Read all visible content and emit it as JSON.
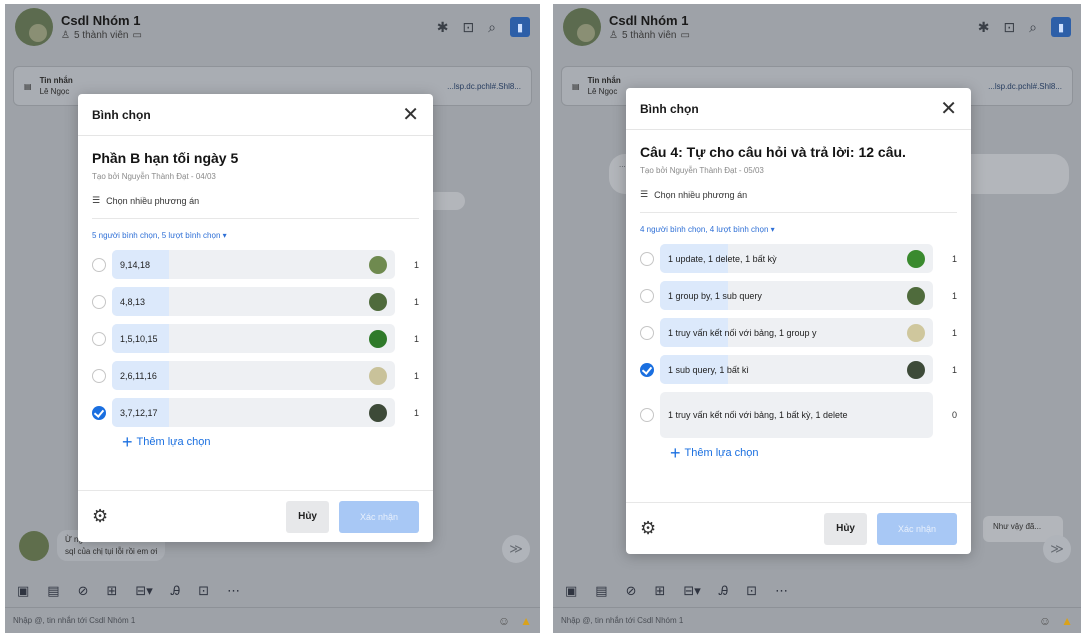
{
  "screens": [
    {
      "group_name": "Csdl Nhóm 1",
      "member_count": "5 thành viên",
      "pinned_title": "Tin nhắn",
      "pinned_sender": "Lê Ngọc",
      "pinned_link": "...lsp.dc.pchl#.Shl8...",
      "bg_bubble": "",
      "bottom_message": [
        "Ừ ngữ",
        "sql của chị tụi lỗi rồi em ơi"
      ],
      "input_placeholder": "Nhập @, tin nhắn tới Csdl Nhóm 1",
      "modal": {
        "title": "Bình chọn",
        "question": "Phần B hạn tối ngày 5",
        "creator": "Tạo bởi Nguyễn Thành Đạt - 04/03",
        "multi_choice_label": "Chọn nhiều phương án",
        "vote_summary": "5 người bình chọn, 5 lượt bình chọn",
        "add_option_label": "Thêm lựa chọn",
        "cancel_label": "Hủy",
        "confirm_label": "Xác nhận",
        "options": [
          {
            "label": "9,14,18",
            "votes": "1",
            "checked": false,
            "share": 0.2,
            "avatar_color": "#6f8a4f"
          },
          {
            "label": "4,8,13",
            "votes": "1",
            "checked": false,
            "share": 0.2,
            "avatar_color": "#4f6b3c"
          },
          {
            "label": "1,5,10,15",
            "votes": "1",
            "checked": false,
            "share": 0.2,
            "avatar_color": "#2f7a2a"
          },
          {
            "label": "2,6,11,16",
            "votes": "1",
            "checked": false,
            "share": 0.2,
            "avatar_color": "#c9c29a"
          },
          {
            "label": "3,7,12,17",
            "votes": "1",
            "checked": true,
            "share": 0.2,
            "avatar_color": "#3d4a38"
          }
        ]
      }
    },
    {
      "group_name": "Csdl Nhóm 1",
      "member_count": "5 thành viên",
      "pinned_title": "Tin nhắn",
      "pinned_sender": "Lê Ngọc",
      "pinned_link": "...lsp.dc.pchl#.Shl8...",
      "bg_bubble": "...",
      "bottom_message": [
        "Như vậy đã..."
      ],
      "input_placeholder": "Nhập @, tin nhắn tới Csdl Nhóm 1",
      "modal": {
        "title": "Bình chọn",
        "question": "Câu 4: Tự cho câu hỏi và trả lời: 12 câu.",
        "creator": "Tạo bởi Nguyễn Thành Đạt - 05/03",
        "multi_choice_label": "Chọn nhiều phương án",
        "vote_summary": "4 người bình chọn, 4 lượt bình chọn",
        "add_option_label": "Thêm lựa chọn",
        "cancel_label": "Hủy",
        "confirm_label": "Xác nhận",
        "options": [
          {
            "label": "1 update, 1 delete, 1 bất kỳ",
            "votes": "1",
            "checked": false,
            "share": 0.25,
            "avatar_color": "#3a8a2e"
          },
          {
            "label": "1 group by, 1 sub query",
            "votes": "1",
            "checked": false,
            "share": 0.25,
            "avatar_color": "#4f6b3c"
          },
          {
            "label": "1 truy vấn kết nối với bảng, 1 group y",
            "votes": "1",
            "checked": false,
            "share": 0.25,
            "avatar_color": "#cfc79d"
          },
          {
            "label": "1 sub query, 1 bất kì",
            "votes": "1",
            "checked": true,
            "share": 0.25,
            "avatar_color": "#3d4a38"
          },
          {
            "label": "1 truy vấn kết nối với bảng, 1 bất kỳ, 1 delete",
            "votes": "0",
            "checked": false,
            "share": 0,
            "avatar_color": "",
            "tall": true
          }
        ]
      }
    }
  ]
}
